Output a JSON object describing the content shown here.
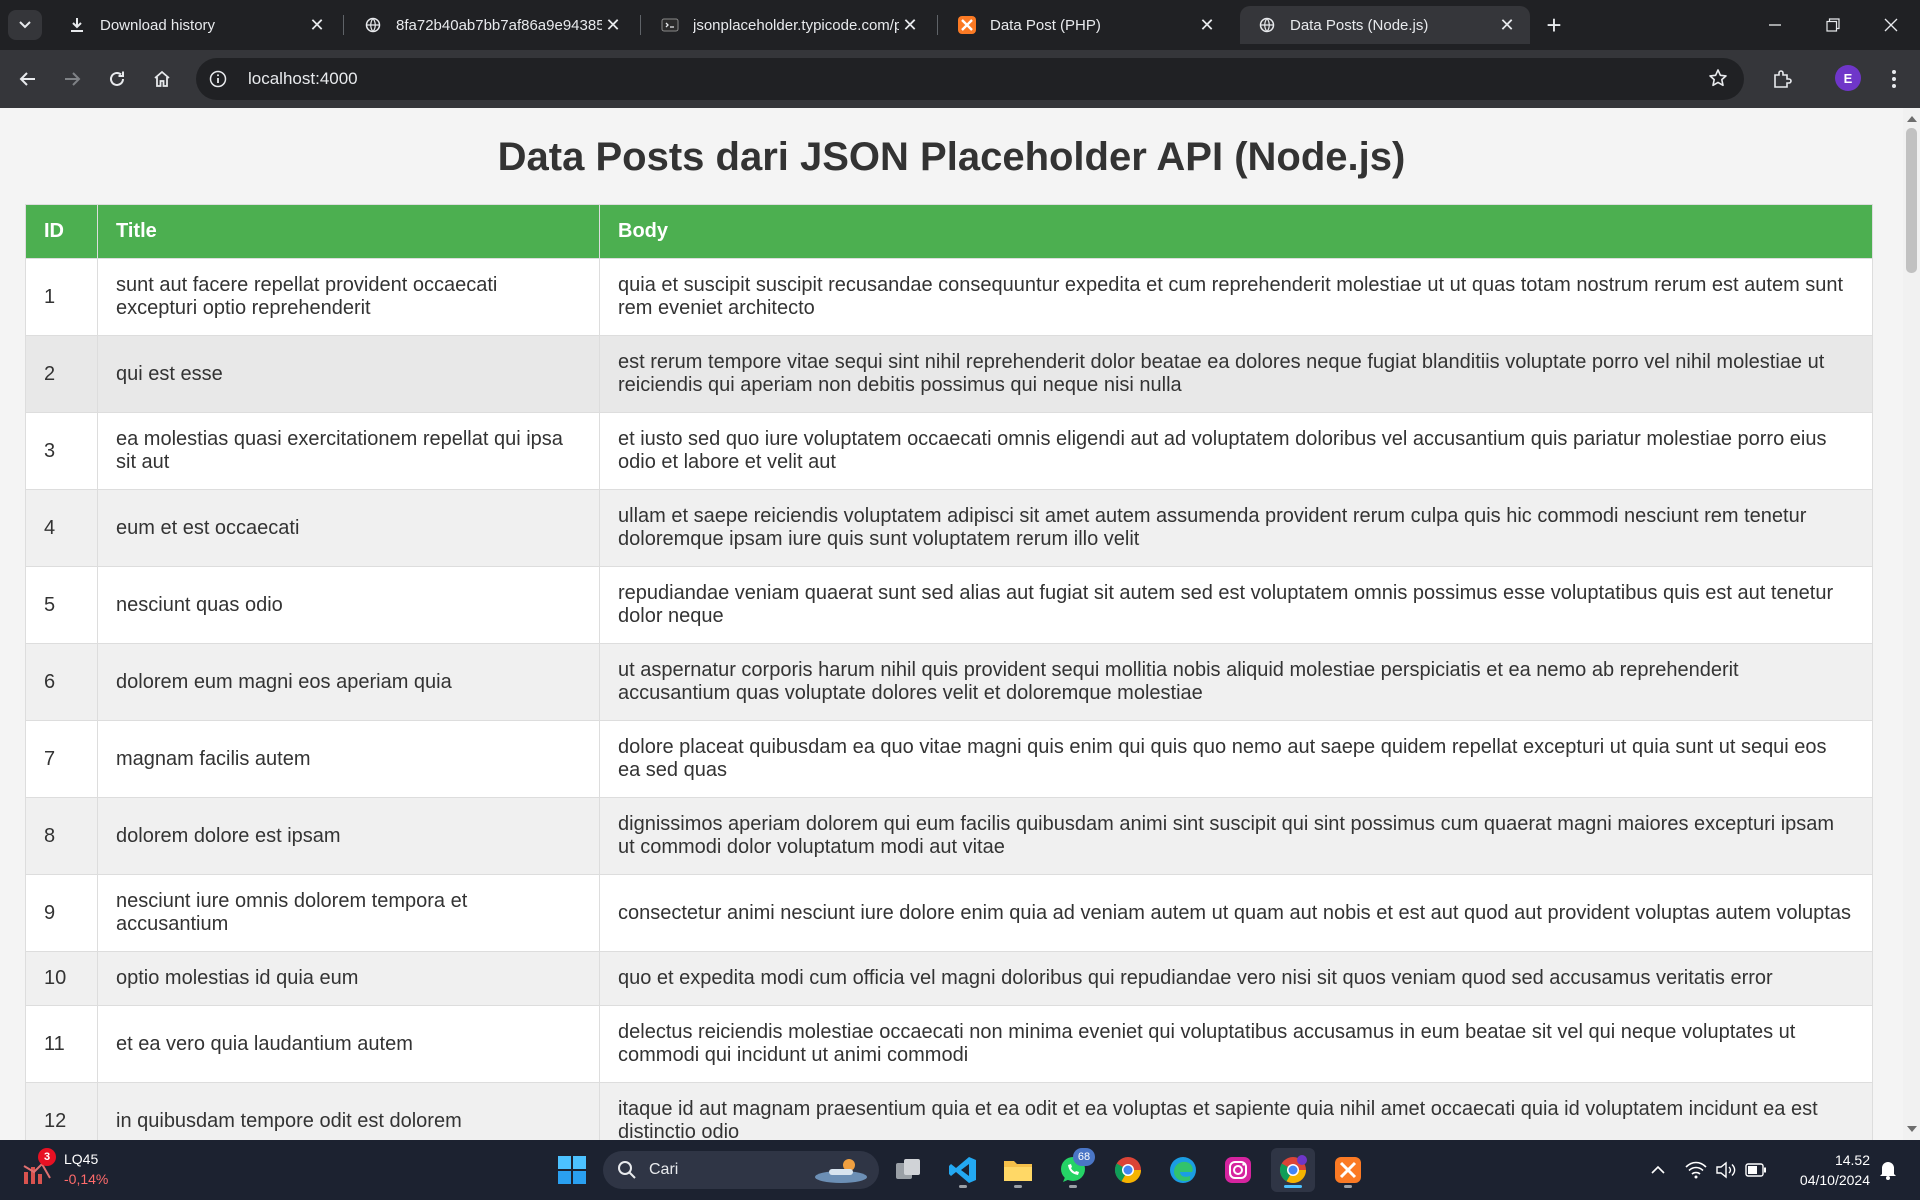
{
  "browser": {
    "tabs": [
      {
        "label": "Download history",
        "icon": "download-icon"
      },
      {
        "label": "8fa72b40ab7bb7af86a9e94385",
        "icon": "globe-icon"
      },
      {
        "label": "jsonplaceholder.typicode.com/p",
        "icon": "jsonplaceholder-icon"
      },
      {
        "label": "Data Post (PHP)",
        "icon": "xampp-icon"
      },
      {
        "label": "Data Posts (Node.js)",
        "icon": "globe-icon",
        "active": true
      }
    ],
    "url": "localhost:4000",
    "profile_initial": "E"
  },
  "page": {
    "heading": "Data Posts dari JSON Placeholder API (Node.js)",
    "table": {
      "headers": [
        "ID",
        "Title",
        "Body"
      ],
      "rows": [
        {
          "id": "1",
          "title": "sunt aut facere repellat provident occaecati excepturi optio reprehenderit",
          "body": "quia et suscipit suscipit recusandae consequuntur expedita et cum reprehenderit molestiae ut ut quas totam nostrum rerum est autem sunt rem eveniet architecto"
        },
        {
          "id": "2",
          "title": "qui est esse",
          "body": "est rerum tempore vitae sequi sint nihil reprehenderit dolor beatae ea dolores neque fugiat blanditiis voluptate porro vel nihil molestiae ut reiciendis qui aperiam non debitis possimus qui neque nisi nulla"
        },
        {
          "id": "3",
          "title": "ea molestias quasi exercitationem repellat qui ipsa sit aut",
          "body": "et iusto sed quo iure voluptatem occaecati omnis eligendi aut ad voluptatem doloribus vel accusantium quis pariatur molestiae porro eius odio et labore et velit aut"
        },
        {
          "id": "4",
          "title": "eum et est occaecati",
          "body": "ullam et saepe reiciendis voluptatem adipisci sit amet autem assumenda provident rerum culpa quis hic commodi nesciunt rem tenetur doloremque ipsam iure quis sunt voluptatem rerum illo velit"
        },
        {
          "id": "5",
          "title": "nesciunt quas odio",
          "body": "repudiandae veniam quaerat sunt sed alias aut fugiat sit autem sed est voluptatem omnis possimus esse voluptatibus quis est aut tenetur dolor neque"
        },
        {
          "id": "6",
          "title": "dolorem eum magni eos aperiam quia",
          "body": "ut aspernatur corporis harum nihil quis provident sequi mollitia nobis aliquid molestiae perspiciatis et ea nemo ab reprehenderit accusantium quas voluptate dolores velit et doloremque molestiae"
        },
        {
          "id": "7",
          "title": "magnam facilis autem",
          "body": "dolore placeat quibusdam ea quo vitae magni quis enim qui quis quo nemo aut saepe quidem repellat excepturi ut quia sunt ut sequi eos ea sed quas"
        },
        {
          "id": "8",
          "title": "dolorem dolore est ipsam",
          "body": "dignissimos aperiam dolorem qui eum facilis quibusdam animi sint suscipit qui sint possimus cum quaerat magni maiores excepturi ipsam ut commodi dolor voluptatum modi aut vitae"
        },
        {
          "id": "9",
          "title": "nesciunt iure omnis dolorem tempora et accusantium",
          "body": "consectetur animi nesciunt iure dolore enim quia ad veniam autem ut quam aut nobis et est aut quod aut provident voluptas autem voluptas"
        },
        {
          "id": "10",
          "title": "optio molestias id quia eum",
          "body": "quo et expedita modi cum officia vel magni doloribus qui repudiandae vero nisi sit quos veniam quod sed accusamus veritatis error"
        },
        {
          "id": "11",
          "title": "et ea vero quia laudantium autem",
          "body": "delectus reiciendis molestiae occaecati non minima eveniet qui voluptatibus accusamus in eum beatae sit vel qui neque voluptates ut commodi qui incidunt ut animi commodi"
        },
        {
          "id": "12",
          "title": "in quibusdam tempore odit est dolorem",
          "body": "itaque id aut magnam praesentium quia et ea odit et ea voluptas et sapiente quia nihil amet occaecati quia id voluptatem incidunt ea est distinctio odio"
        }
      ]
    }
  },
  "taskbar": {
    "stock_symbol": "LQ45",
    "stock_change": "-0,14%",
    "stock_badge": "3",
    "search_label": "Cari",
    "whatsapp_badge": "68",
    "time": "14.52",
    "date": "04/10/2024"
  },
  "colors": {
    "header_green": "#4caf50",
    "browser_dark": "#202124",
    "toolbar": "#35363a"
  }
}
